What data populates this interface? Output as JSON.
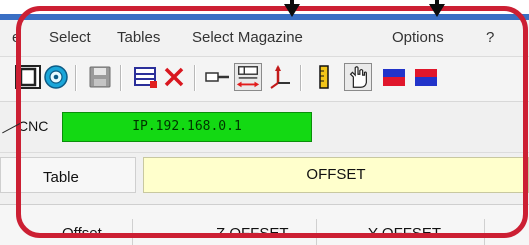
{
  "menu": {
    "items": [
      "e",
      "Select",
      "Tables",
      "Select Magazine",
      "Options",
      "?"
    ]
  },
  "toolbar": {
    "icons": [
      "table-grid-icon",
      "disc-icon",
      "save-icon",
      "add-table-icon",
      "delete-x-icon",
      "offset-single-icon",
      "offset-measure-icon",
      "axes-icon",
      "ruler-icon",
      "hand-icon",
      "flag-blue-red-icon",
      "flag-red-blue-icon"
    ]
  },
  "cnc": {
    "label": "CNC",
    "address": "IP.192.168.0.1"
  },
  "table": {
    "label": "Table",
    "value": "OFFSET"
  },
  "columns": {
    "offset": "Offset",
    "z_offset": "Z OFFSET",
    "y_offset": "Y OFFSET"
  },
  "colors": {
    "frame": "#cc1f33",
    "cnc_field": "#13d913",
    "table_field": "#ffffcc",
    "arrow": "#0d0d0d"
  }
}
